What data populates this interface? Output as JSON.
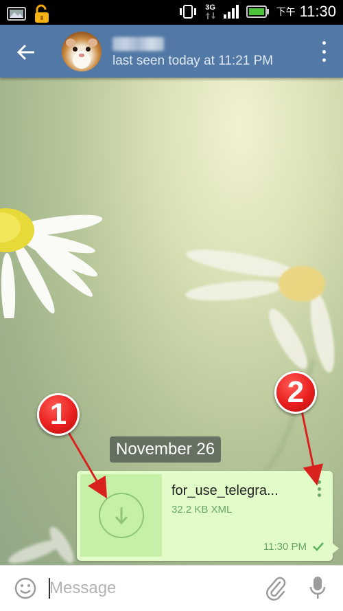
{
  "status_bar": {
    "network": "3G",
    "clock_suffix": "下午",
    "time": "11:30"
  },
  "header": {
    "status": "last seen today at 11:21 PM",
    "back_icon": "arrow-left-icon",
    "menu_icon": "more-vertical-icon",
    "color": "#5279a6"
  },
  "chat": {
    "date_separator": "November 26",
    "message": {
      "file_name": "for_use_telegra...",
      "file_meta": "32.2 KB XML",
      "time": "11:30 PM",
      "bubble_color": "#e1fcc8"
    }
  },
  "annotations": {
    "badge_1": "1",
    "badge_2": "2",
    "color": "#e8201e"
  },
  "input": {
    "placeholder": "Message"
  }
}
